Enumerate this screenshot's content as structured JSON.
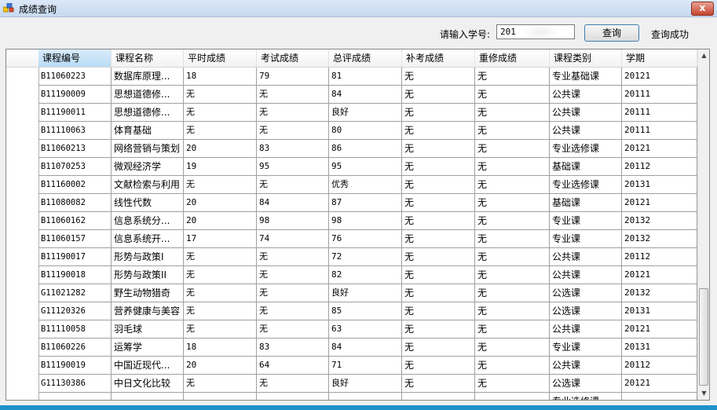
{
  "window": {
    "title": "成绩查询",
    "close_label": "x"
  },
  "toolbar": {
    "student_id_label": "请输入学号:",
    "student_id_value": "201",
    "query_button": "查询",
    "status_text": "查询成功"
  },
  "table": {
    "columns": [
      "课程编号",
      "课程名称",
      "平时成绩",
      "考试成绩",
      "总评成绩",
      "补考成绩",
      "重修成绩",
      "课程类别",
      "学期"
    ],
    "rows": [
      [
        "B11060223",
        "数据库原理...",
        "18",
        "79",
        "81",
        "无",
        "无",
        "专业基础课",
        "20121"
      ],
      [
        "B11190009",
        "思想道德修...",
        "无",
        "无",
        "84",
        "无",
        "无",
        "公共课",
        "20111"
      ],
      [
        "B11190011",
        "思想道德修...",
        "无",
        "无",
        "良好",
        "无",
        "无",
        "公共课",
        "20111"
      ],
      [
        "B11110063",
        "体育基础",
        "无",
        "无",
        "80",
        "无",
        "无",
        "公共课",
        "20111"
      ],
      [
        "B11060213",
        "网络营销与策划",
        "20",
        "83",
        "86",
        "无",
        "无",
        "专业选修课",
        "20121"
      ],
      [
        "B11070253",
        "微观经济学",
        "19",
        "95",
        "95",
        "无",
        "无",
        "基础课",
        "20112"
      ],
      [
        "B11160002",
        "文献检索与利用",
        "无",
        "无",
        "优秀",
        "无",
        "无",
        "专业选修课",
        "20131"
      ],
      [
        "B11080082",
        "线性代数",
        "20",
        "84",
        "87",
        "无",
        "无",
        "基础课",
        "20121"
      ],
      [
        "B11060162",
        "信息系统分...",
        "20",
        "98",
        "98",
        "无",
        "无",
        "专业课",
        "20132"
      ],
      [
        "B11060157",
        "信息系统开...",
        "17",
        "74",
        "76",
        "无",
        "无",
        "专业课",
        "20132"
      ],
      [
        "B11190017",
        "形势与政策I",
        "无",
        "无",
        "72",
        "无",
        "无",
        "公共课",
        "20112"
      ],
      [
        "B11190018",
        "形势与政策II",
        "无",
        "无",
        "82",
        "无",
        "无",
        "公共课",
        "20121"
      ],
      [
        "G11021282",
        "野生动物猎奇",
        "无",
        "无",
        "良好",
        "无",
        "无",
        "公选课",
        "20132"
      ],
      [
        "G11120326",
        "营养健康与美容",
        "无",
        "无",
        "85",
        "无",
        "无",
        "公选课",
        "20131"
      ],
      [
        "B11110058",
        "羽毛球",
        "无",
        "无",
        "63",
        "无",
        "无",
        "公共课",
        "20121"
      ],
      [
        "B11060226",
        "运筹学",
        "18",
        "83",
        "84",
        "无",
        "无",
        "专业课",
        "20131"
      ],
      [
        "B11190019",
        "中国近现代...",
        "20",
        "64",
        "71",
        "无",
        "无",
        "公共课",
        "20112"
      ],
      [
        "G11130386",
        "中日文化比较",
        "无",
        "无",
        "良好",
        "无",
        "无",
        "公选课",
        "20121"
      ],
      [
        "",
        "",
        "",
        "",
        "",
        "",
        "",
        "专业选修课",
        ""
      ]
    ]
  }
}
